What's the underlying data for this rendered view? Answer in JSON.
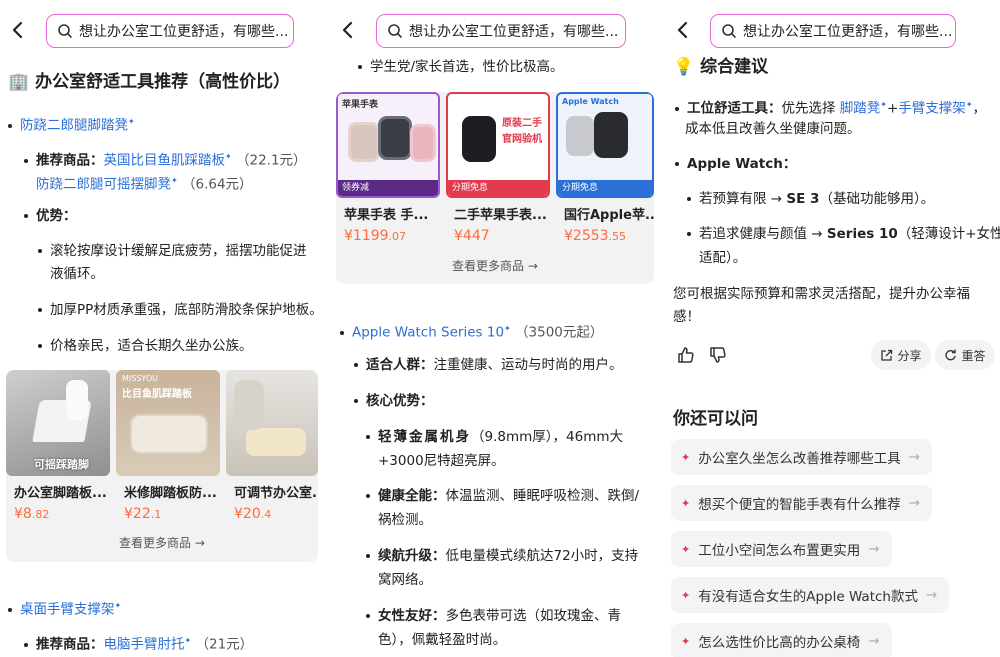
{
  "search": {
    "query": "想让办公室工位更舒适，有哪些..."
  },
  "panel1": {
    "title_emoji": "🏢",
    "title": "办公室舒适工具推荐（高性价比）",
    "section1_name": "防跷二郎腿脚踏凳",
    "rec_label": "推荐商品：",
    "rec_item1": "英国比目鱼肌踩踏板",
    "rec_item1_price": "（22.1元）",
    "rec_item2": "防跷二郎腿可摇摆脚凳",
    "rec_item2_price": "（6.64元）",
    "adv_label": "优势：",
    "adv1_l1": "滚轮按摩设计缓解足底疲劳，摇摆功能促进",
    "adv1_l2": "液循环。",
    "adv2": "加厚PP材质承重强，底部防滑胶条保护地板。",
    "adv3": "价格亲民，适合长期久坐办公族。",
    "products": [
      {
        "title": "办公室脚踏板...",
        "price_int": "¥8",
        "price_dec": ".82",
        "overlay": "可摇踩踏脚"
      },
      {
        "title": "米修脚踏板防...",
        "price_int": "¥22",
        "price_dec": ".1",
        "overlay_top": "MISSYOU",
        "overlay": "比目鱼肌踩踏板"
      },
      {
        "title": "可调节办公室...",
        "price_int": "¥20",
        "price_dec": ".4",
        "overlay": ""
      }
    ],
    "more": "查看更多商品",
    "section2_name": "桌面手臂支撑架",
    "rec2_label": "推荐商品：",
    "rec2_item": "电脑手臂肘托",
    "rec2_price": "（21元）"
  },
  "panel2": {
    "top_line": "学生党/家长首选，性价比极高。",
    "products": [
      {
        "title": "苹果手表 手...",
        "price_int": "¥1199",
        "price_dec": ".07",
        "tag": "苹果手表",
        "badge": "领券减"
      },
      {
        "title": "二手苹果手表...",
        "price_int": "¥447",
        "price_dec": "",
        "tag": "原装二手",
        "tag2": "官网验机",
        "badge": "分期免息"
      },
      {
        "title": "国行Apple苹...",
        "price_int": "¥2553",
        "price_dec": ".55",
        "tag": "Apple Watch",
        "badge": "分期免息"
      }
    ],
    "more": "查看更多商品",
    "series_name": "Apple Watch Series 10",
    "series_price": "（3500元起）",
    "crowd_label": "适合人群：",
    "crowd_text": "注重健康、运动与时尚的用户。",
    "core_label": "核心优势：",
    "f1_label": "轻薄金属机身",
    "f1_text": "（9.8mm厚），46mm大",
    "f1_l2": "+3000尼特超亮屏。",
    "f2_label": "健康全能：",
    "f2_text": "体温监测、睡眠呼吸检测、跌倒/",
    "f2_l2": "祸检测。",
    "f3_label": "续航升级：",
    "f3_text": "低电量模式续航达72小时，支持",
    "f3_l2": "窝网络。",
    "f4_label": "女性友好：",
    "f4_text": "多色表带可选（如玫瑰金、青",
    "f4_l2": "色），佩戴轻盈时尚。"
  },
  "panel3": {
    "title_emoji": "💡",
    "title": "综合建议",
    "s1_label": "工位舒适工具：",
    "s1_text": "优先选择",
    "s1_link": "脚踏凳",
    "s1_plus": "+",
    "s1_link2": "手臂支撑架",
    "s1_end": "，",
    "s1_l2": "成本低且改善久坐健康问题。",
    "s2_label": "Apple Watch：",
    "s2a_text": "若预算有限 → ",
    "s2a_bold": "SE 3",
    "s2a_end": "（基础功能够用）。",
    "s2b_text": "若追求健康与颜值 → ",
    "s2b_bold": "Series 10",
    "s2b_end": "（轻薄设计+女性",
    "s2b_l2": "适配）。",
    "summary_l1": "您可根据实际预算和需求灵活搭配，提升办公幸福",
    "summary_l2": "感！",
    "share": "分享",
    "retry": "重答",
    "also_title": "你还可以问",
    "questions": [
      "办公室久坐怎么改善推荐哪些工具",
      "想买个便宜的智能手表有什么推荐",
      "工位小空间怎么布置更实用",
      "有没有适合女生的Apple Watch款式",
      "怎么选性价比高的办公桌椅"
    ]
  }
}
